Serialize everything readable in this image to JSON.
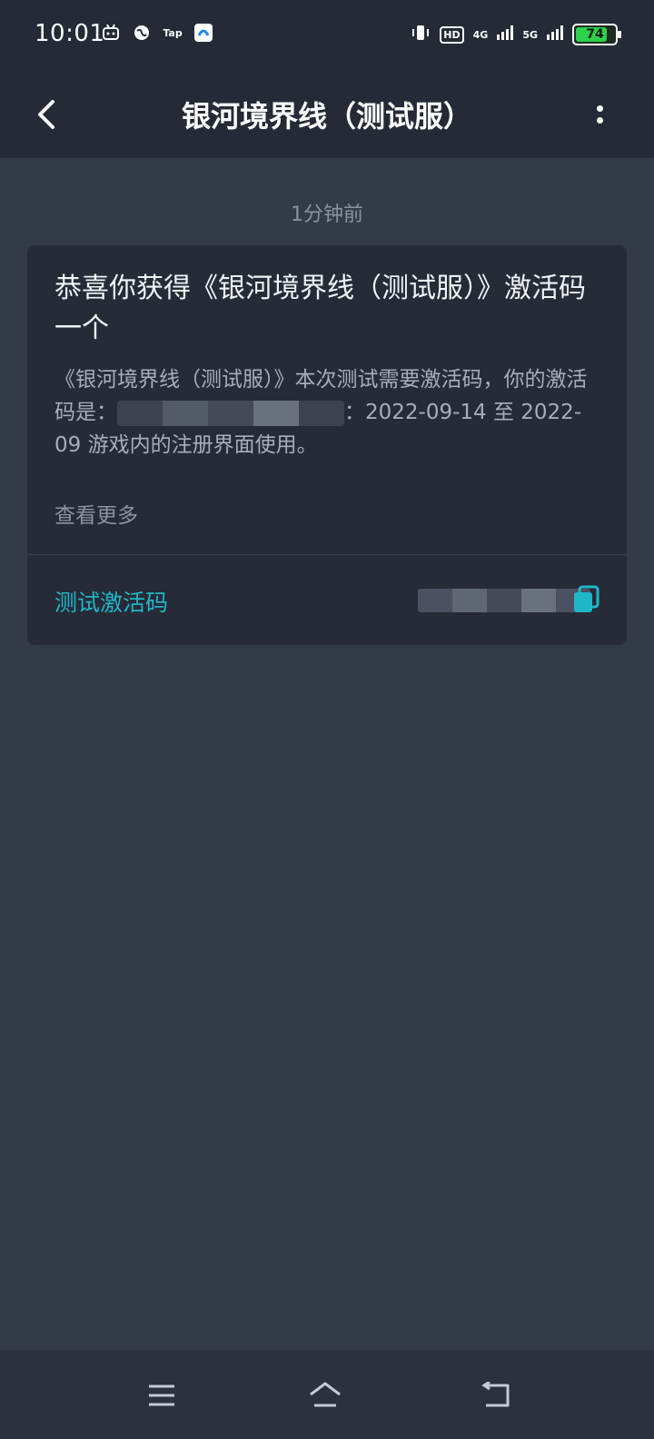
{
  "status_bar": {
    "time": "10:01",
    "left_icons": [
      "bilibili-icon",
      "globe-icon",
      "tap-icon",
      "app-icon"
    ],
    "tap_label": "Tap",
    "hd_label": "HD",
    "network_labels": [
      "4G",
      "5G"
    ],
    "battery_level": "74",
    "battery_fraction": 0.74
  },
  "header": {
    "title": "银河境界线（测试服）"
  },
  "message": {
    "timestamp": "1分钟前",
    "title": "恭喜你获得《银河境界线（测试服）》激活码一个",
    "body_before": "《银河境界线（测试服）》本次测试需要激活码，你的激活码是：",
    "body_after": "：2022-09-14 至 2022-09 游戏内的注册界面使用。",
    "see_more": "查看更多",
    "code_label": "测试激活码"
  },
  "colors": {
    "accent": "#1fb7c8",
    "background": "#333a48",
    "card": "#262b37",
    "battery": "#2bd24a"
  }
}
